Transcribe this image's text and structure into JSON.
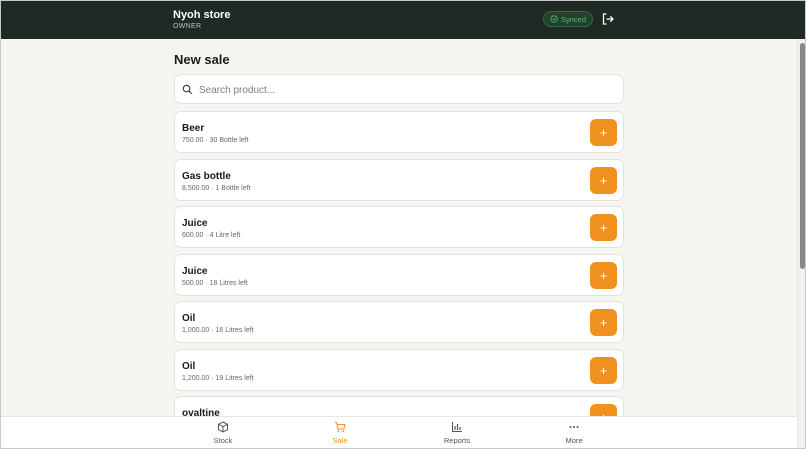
{
  "header": {
    "store_name": "Nyoh store",
    "role": "OWNER",
    "sync_status": "Synced",
    "sync_icon": "check-circle-icon",
    "logout_icon": "logout-icon"
  },
  "page": {
    "title": "New sale"
  },
  "search": {
    "placeholder": "Search product...",
    "value": "",
    "icon": "search-icon"
  },
  "products": [
    {
      "name": "Beer",
      "meta": "750.00 · 30 Bottle left"
    },
    {
      "name": "Gas bottle",
      "meta": "8,500.00 · 1 Bottle left"
    },
    {
      "name": "Juice",
      "meta": "600.00 · 4 Litre left"
    },
    {
      "name": "Juice",
      "meta": "500.00 · 18 Litres left"
    },
    {
      "name": "Oil",
      "meta": "1,000.00 · 16 Litres left"
    },
    {
      "name": "Oil",
      "meta": "1,200.00 · 19 Litres left"
    },
    {
      "name": "ovaltine",
      "meta": ""
    }
  ],
  "add_button_label": "+",
  "nav": [
    {
      "label": "Stock",
      "icon": "box-icon",
      "active": false
    },
    {
      "label": "Sale",
      "icon": "cart-icon",
      "active": true
    },
    {
      "label": "Reports",
      "icon": "bar-chart-icon",
      "active": false
    },
    {
      "label": "More",
      "icon": "more-horizontal-icon",
      "active": false
    }
  ],
  "colors": {
    "header_bg": "#1f2a24",
    "accent": "#f0901e",
    "synced_green": "#4fbf74",
    "page_bg": "#f7f5f1"
  }
}
